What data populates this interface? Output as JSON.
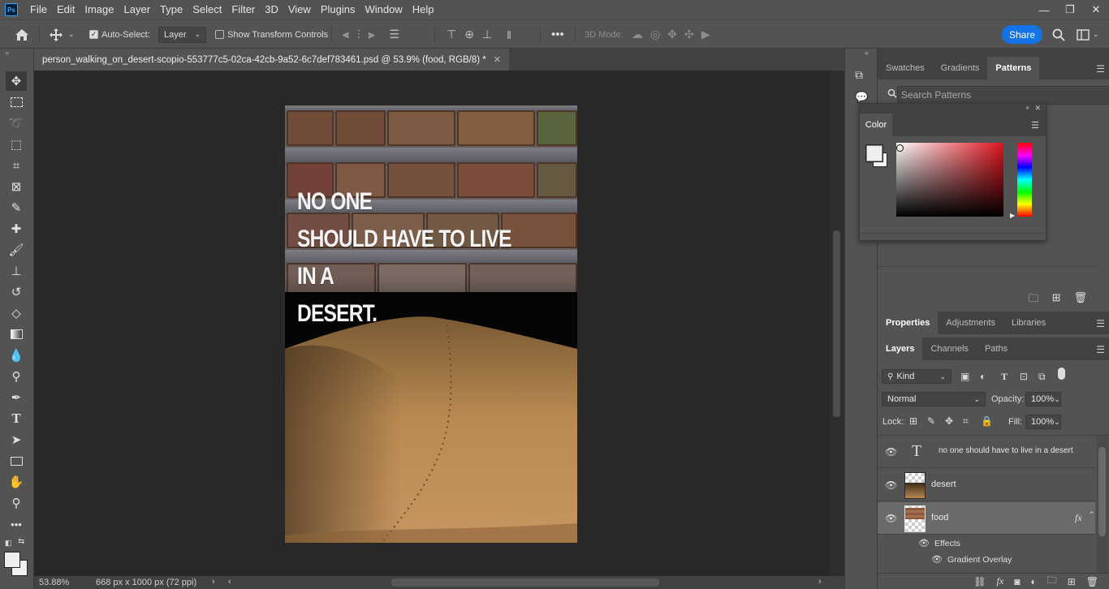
{
  "colors": {
    "accent": "#1473e6",
    "chrome": "#535353",
    "canvas_bg": "#282828"
  },
  "menu": [
    "File",
    "Edit",
    "Image",
    "Layer",
    "Type",
    "Select",
    "Filter",
    "3D",
    "View",
    "Plugins",
    "Window",
    "Help"
  ],
  "app_icon_text": "Ps",
  "window_controls": {
    "minimize": "—",
    "restore": "❐",
    "close": "✕"
  },
  "options": {
    "auto_select_label": "Auto-Select:",
    "auto_select_target": "Layer",
    "transform_label": "Show Transform Controls",
    "mode_3d_label": "3D Mode:",
    "share_label": "Share"
  },
  "document": {
    "tab_title": "person_walking_on_desert-scopio-553777c5-02ca-42cb-9a52-6c7def783461.psd @ 53.9% (food, RGB/8) *",
    "headline": "NO ONE\nSHOULD HAVE TO LIVE IN A\nDESERT."
  },
  "status": {
    "zoom": "53.88%",
    "dimensions": "668 px x 1000 px (72 ppi)"
  },
  "swatch_panel": {
    "tabs": [
      "Swatches",
      "Gradients",
      "Patterns"
    ],
    "active_tab": "Patterns",
    "search_placeholder": "Search Patterns"
  },
  "color_panel": {
    "title": "Color"
  },
  "props_panel": {
    "tabs": [
      "Properties",
      "Adjustments",
      "Libraries"
    ],
    "active_tab": "Properties"
  },
  "layers_panel": {
    "tabs": [
      "Layers",
      "Channels",
      "Paths"
    ],
    "active_tab": "Layers",
    "filter_kind": "Kind",
    "blend_mode": "Normal",
    "opacity_label": "Opacity:",
    "opacity_value": "100%",
    "lock_label": "Lock:",
    "fill_label": "Fill:",
    "fill_value": "100%",
    "layers": [
      {
        "name": "no one should have to live in a desert",
        "type": "text"
      },
      {
        "name": "desert",
        "type": "image"
      },
      {
        "name": "food",
        "type": "image",
        "selected": true,
        "fx": "fx"
      }
    ],
    "effects_label": "Effects",
    "effect_name": "Gradient Overlay"
  }
}
